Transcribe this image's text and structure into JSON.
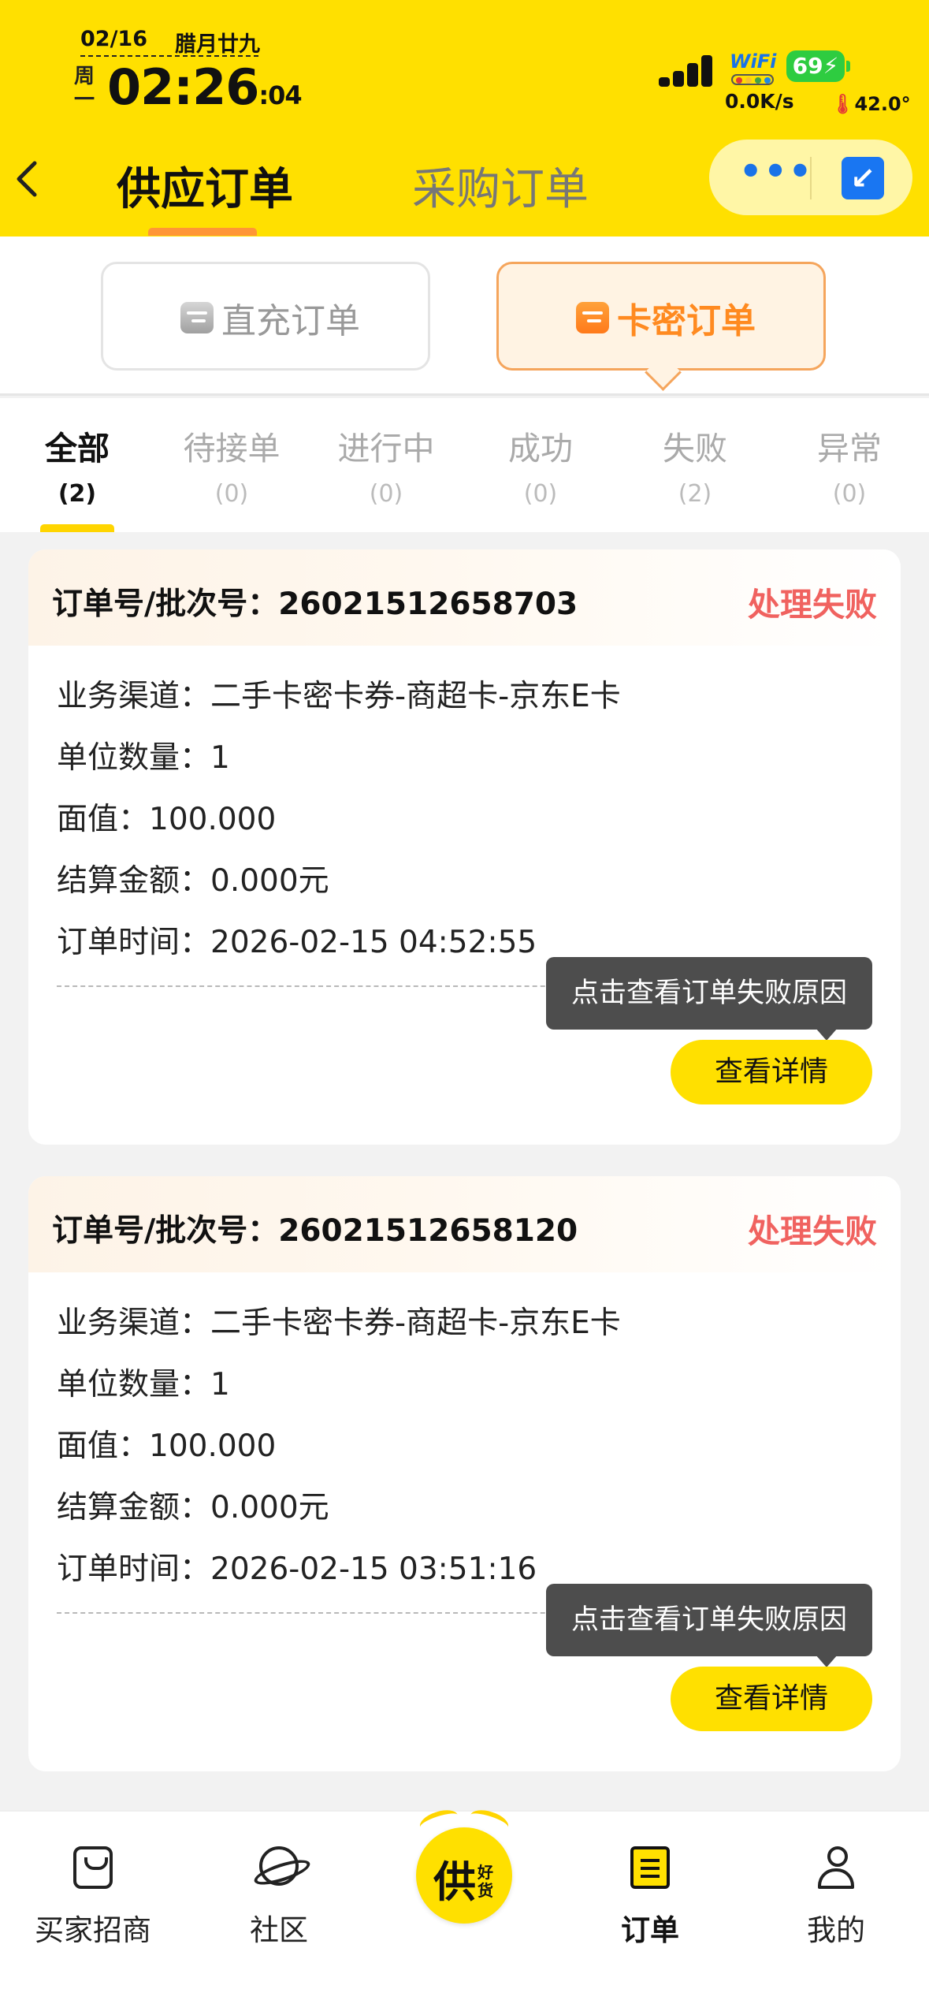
{
  "status_bar": {
    "date": "02/16",
    "lunar": "腊月廿九",
    "weekday_top": "周",
    "weekday_bottom": "一",
    "time": "02:26",
    "seconds": ":04",
    "wifi_label": "WiFi",
    "battery": "69",
    "net_speed": "0.0K/s",
    "temperature": "42.0°"
  },
  "nav": {
    "back_icon": "chevron-left-icon",
    "tabs": [
      "供应订单",
      "采购订单"
    ],
    "active_tab": 0,
    "more": "•••",
    "mini_icon": "↙"
  },
  "order_type": {
    "options": [
      "直充订单",
      "卡密订单"
    ],
    "selected": 1
  },
  "status_tabs": [
    {
      "label": "全部",
      "count": "(2)"
    },
    {
      "label": "待接单",
      "count": "(0)"
    },
    {
      "label": "进行中",
      "count": "(0)"
    },
    {
      "label": "成功",
      "count": "(0)"
    },
    {
      "label": "失败",
      "count": "(2)"
    },
    {
      "label": "异常",
      "count": "(0)"
    }
  ],
  "orders": [
    {
      "order_no": "订单号/批次号：26021512658703",
      "status": "处理失败",
      "channel": "业务渠道：二手卡密卡券-商超卡-京东E卡",
      "quantity": "单位数量：1",
      "face_value": "面值：100.000",
      "settlement": "结算金额：0.000元",
      "time": "订单时间：2026-02-15 04:52:55",
      "tooltip": "点击查看订单失败原因",
      "detail_btn": "查看详情"
    },
    {
      "order_no": "订单号/批次号：26021512658120",
      "status": "处理失败",
      "channel": "业务渠道：二手卡密卡券-商超卡-京东E卡",
      "quantity": "单位数量：1",
      "face_value": "面值：100.000",
      "settlement": "结算金额：0.000元",
      "time": "订单时间：2026-02-15 03:51:16",
      "tooltip": "点击查看订单失败原因",
      "detail_btn": "查看详情"
    }
  ],
  "bottom_nav": {
    "items": [
      {
        "label": "买家招商",
        "icon": "shopping-bag-icon"
      },
      {
        "label": "社区",
        "icon": "planet-icon"
      },
      {
        "label": "订单",
        "icon": "order-document-icon"
      },
      {
        "label": "我的",
        "icon": "user-icon"
      }
    ],
    "center_big": "供",
    "center_small": "好货",
    "active_index": 2
  },
  "colors": {
    "brand_yellow": "#ffe000",
    "accent_orange": "#ff8a20",
    "failure_red": "#f0625f"
  }
}
